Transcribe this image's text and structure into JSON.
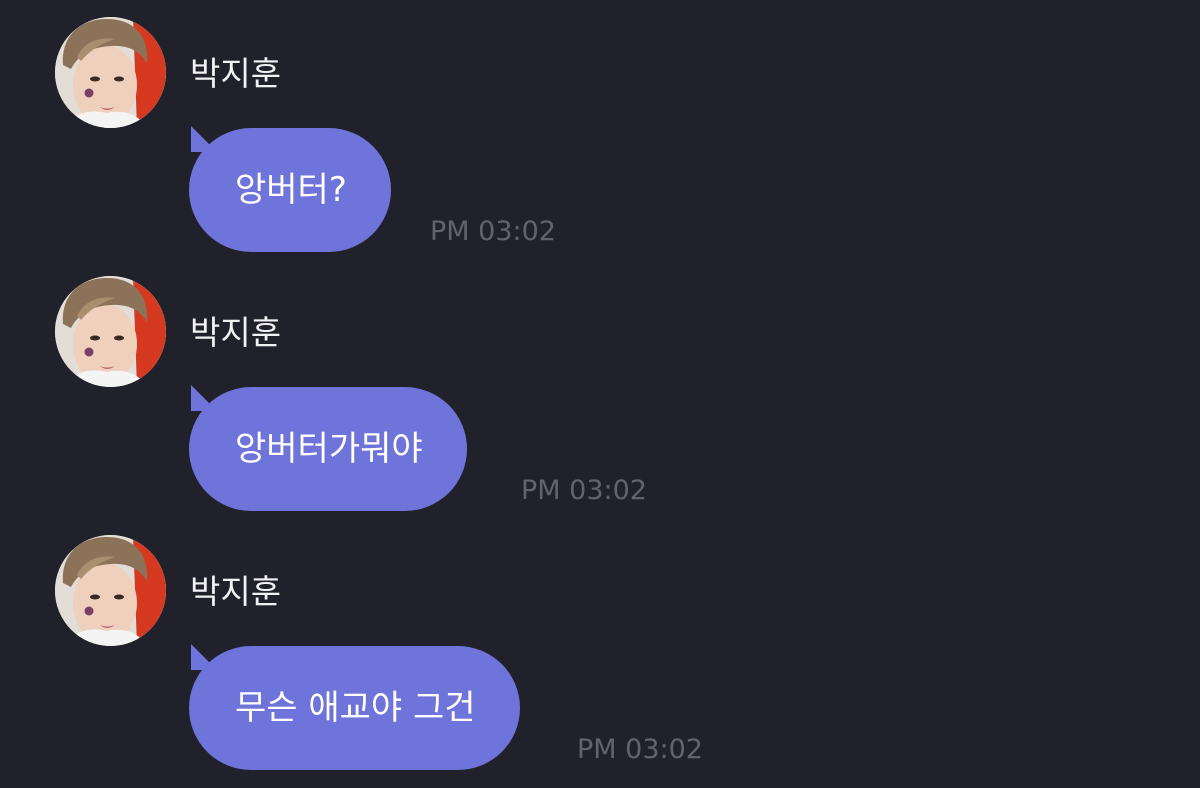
{
  "messages": [
    {
      "sender": "박지훈",
      "text": "앙버터?",
      "time": "PM 03:02",
      "avatar_icon": "profile-photo"
    },
    {
      "sender": "박지훈",
      "text": "앙버터가뭐야",
      "time": "PM 03:02",
      "avatar_icon": "profile-photo"
    },
    {
      "sender": "박지훈",
      "text": "무슨 애교야 그건",
      "time": "PM 03:02",
      "avatar_icon": "profile-photo"
    }
  ],
  "colors": {
    "background": "#21212b",
    "bubble": "#6e74d9",
    "sender_text": "#f2f2f5",
    "timestamp": "#63636f"
  }
}
